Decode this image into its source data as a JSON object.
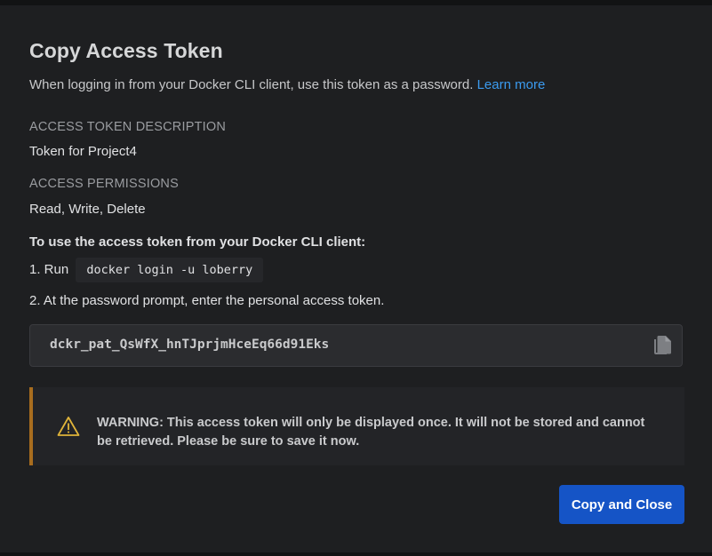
{
  "dialog": {
    "title": "Copy Access Token",
    "subtitle": "When logging in from your Docker CLI client, use this token as a password.",
    "learn_more": "Learn more"
  },
  "description": {
    "label": "ACCESS TOKEN DESCRIPTION",
    "value": "Token for Project4"
  },
  "permissions": {
    "label": "ACCESS PERMISSIONS",
    "value": "Read, Write, Delete"
  },
  "instructions": {
    "heading": "To use the access token from your Docker CLI client:",
    "step1_prefix": "1. Run",
    "step1_command": "docker login -u loberry",
    "step2": "2. At the password prompt, enter the personal access token."
  },
  "token": {
    "value": "dckr_pat_QsWfX_hnTJprjmHceEq66d91Eks",
    "copy_icon": "copy-icon"
  },
  "warning": {
    "icon": "warning-triangle-icon",
    "text": "WARNING: This access token will only be displayed once. It will not be stored and cannot be retrieved. Please be sure to save it now."
  },
  "actions": {
    "copy_and_close": "Copy and Close"
  },
  "colors": {
    "background": "#1e1f21",
    "link": "#3b9bf0",
    "primary_button": "#1554c6",
    "warning_accent": "#a86d1e"
  }
}
